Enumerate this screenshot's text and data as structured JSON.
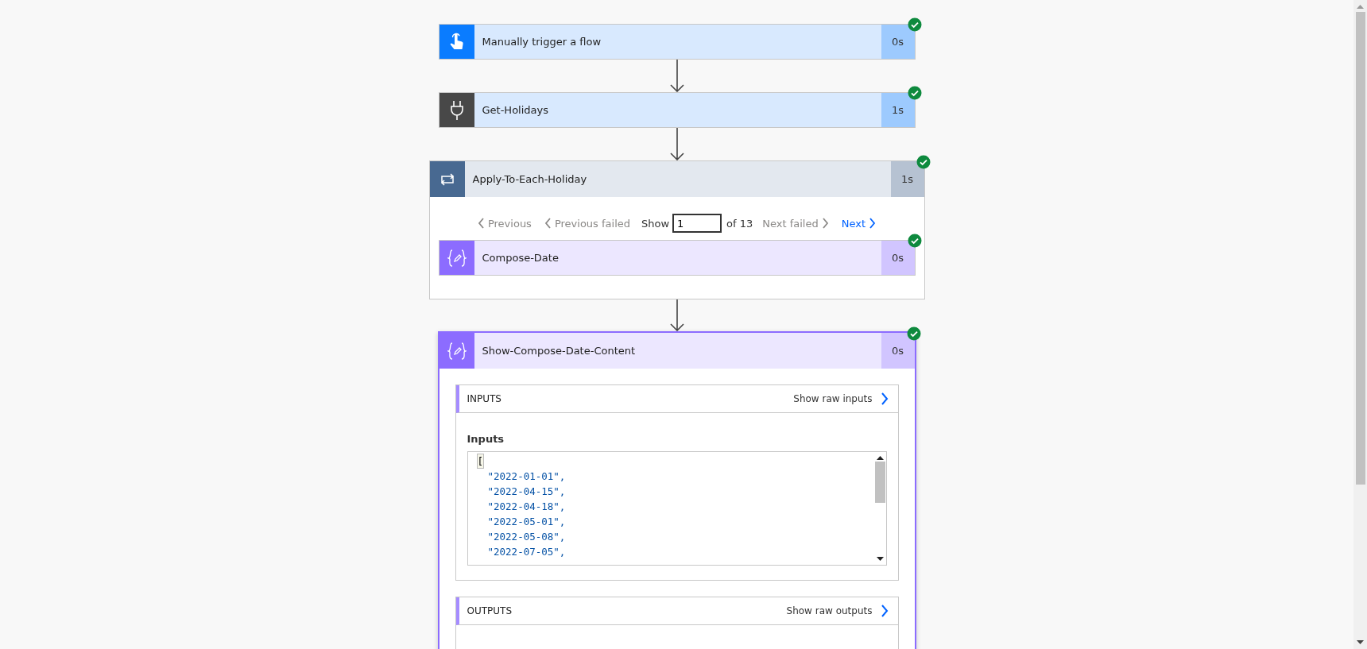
{
  "steps": [
    {
      "kind": "trigger",
      "title": "Manually trigger a flow",
      "duration": "0s",
      "succeeded": true
    },
    {
      "kind": "connector",
      "title": "Get-Holidays",
      "duration": "1s",
      "succeeded": true
    },
    {
      "kind": "loop",
      "title": "Apply-To-Each-Holiday",
      "duration": "1s",
      "succeeded": true,
      "pager": {
        "previous": {
          "label": "Previous",
          "disabled": true
        },
        "previous_failed": {
          "label": "Previous failed",
          "disabled": true
        },
        "show_label": "Show",
        "index": "1",
        "of_label": "of 13",
        "next_failed": {
          "label": "Next failed",
          "disabled": true
        },
        "next": {
          "label": "Next",
          "disabled": false
        }
      },
      "children": [
        {
          "kind": "compose",
          "title": "Compose-Date",
          "duration": "0s",
          "succeeded": true
        }
      ]
    },
    {
      "kind": "compose",
      "title": "Show-Compose-Date-Content",
      "duration": "0s",
      "succeeded": true,
      "expanded": true,
      "sections": [
        {
          "title": "INPUTS",
          "raw_link": "Show raw inputs",
          "field_label": "Inputs",
          "code_lines": [
            {
              "kind": "punct",
              "text": "["
            },
            {
              "kind": "string",
              "text": "\"2022-01-01\","
            },
            {
              "kind": "string",
              "text": "\"2022-04-15\","
            },
            {
              "kind": "string",
              "text": "\"2022-04-18\","
            },
            {
              "kind": "string",
              "text": "\"2022-05-01\","
            },
            {
              "kind": "string",
              "text": "\"2022-05-08\","
            },
            {
              "kind": "string",
              "text": "\"2022-07-05\","
            }
          ]
        },
        {
          "title": "OUTPUTS",
          "raw_link": "Show raw outputs"
        }
      ]
    }
  ]
}
